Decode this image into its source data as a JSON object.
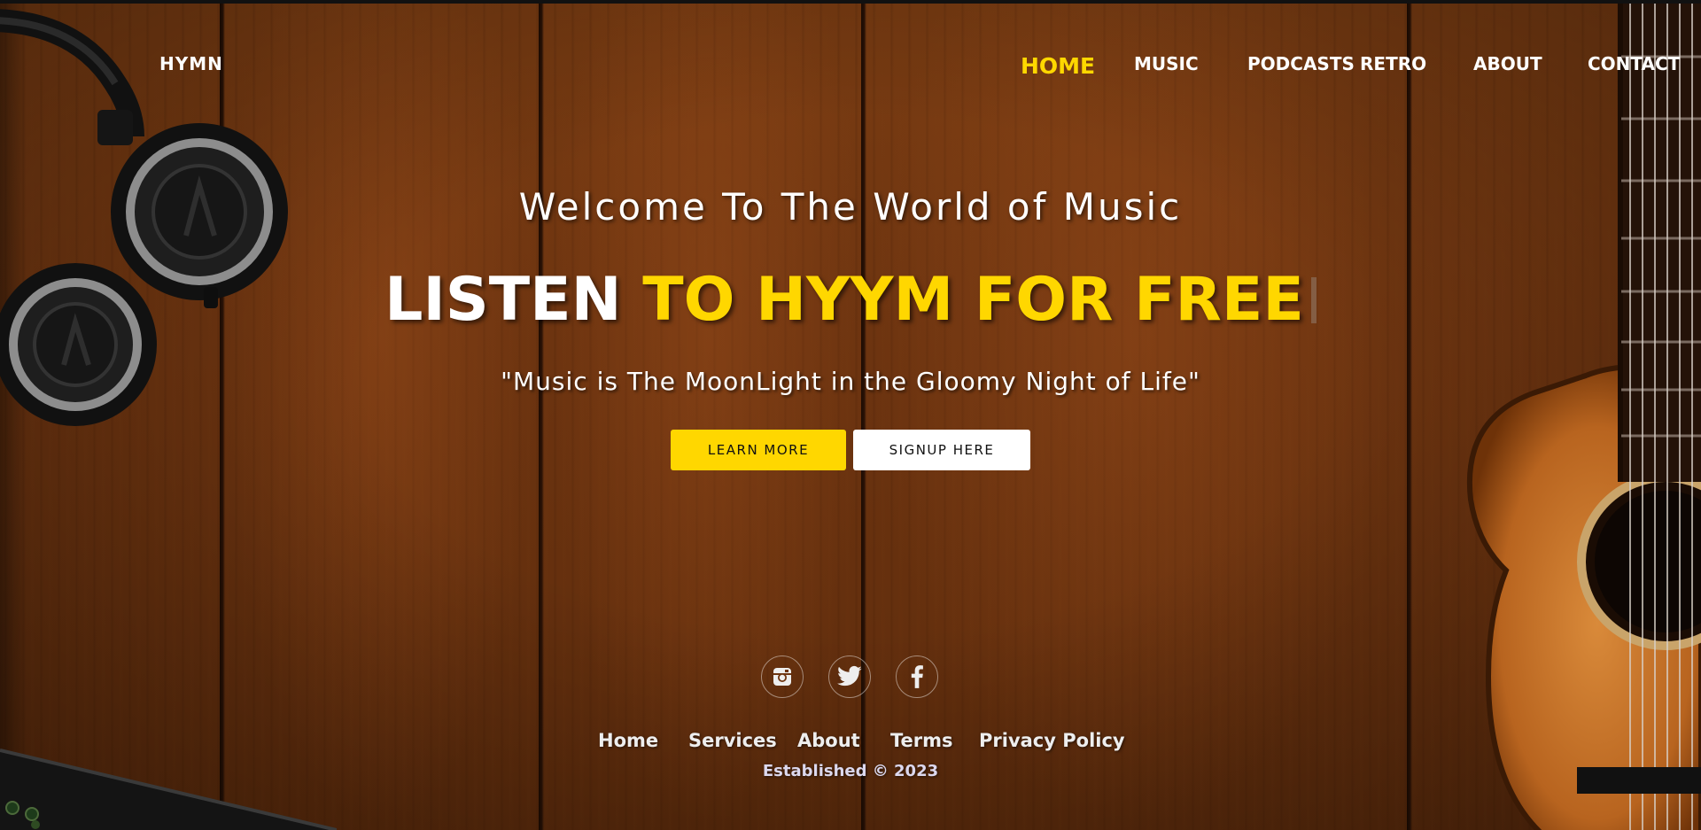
{
  "nav": {
    "brand": "HYMN",
    "items": [
      {
        "label": "HOME",
        "active": true
      },
      {
        "label": "MUSIC",
        "active": false
      },
      {
        "label": "PODCASTS",
        "active": false
      },
      {
        "label": "RETRO",
        "active": false
      },
      {
        "label": "ABOUT",
        "active": false
      },
      {
        "label": "CONTACT",
        "active": false
      }
    ]
  },
  "hero": {
    "welcome": "Welcome To The World of Music",
    "headline_white": "LISTEN",
    "headline_yellow": "TO HYYM FOR FREE",
    "quote": "\"Music is The MoonLight in the Gloomy Night of Life\"",
    "learn_more": "LEARN MORE",
    "signup": "SIGNUP HERE"
  },
  "footer": {
    "social": [
      {
        "icon": "instagram-icon"
      },
      {
        "icon": "twitter-icon"
      },
      {
        "icon": "facebook-icon"
      }
    ],
    "links": [
      "Home",
      "Services",
      "About",
      "Terms",
      "Privacy Policy"
    ],
    "established": "Established © 2023"
  },
  "colors": {
    "accent": "#ffd700",
    "wood": "#6d3410"
  }
}
